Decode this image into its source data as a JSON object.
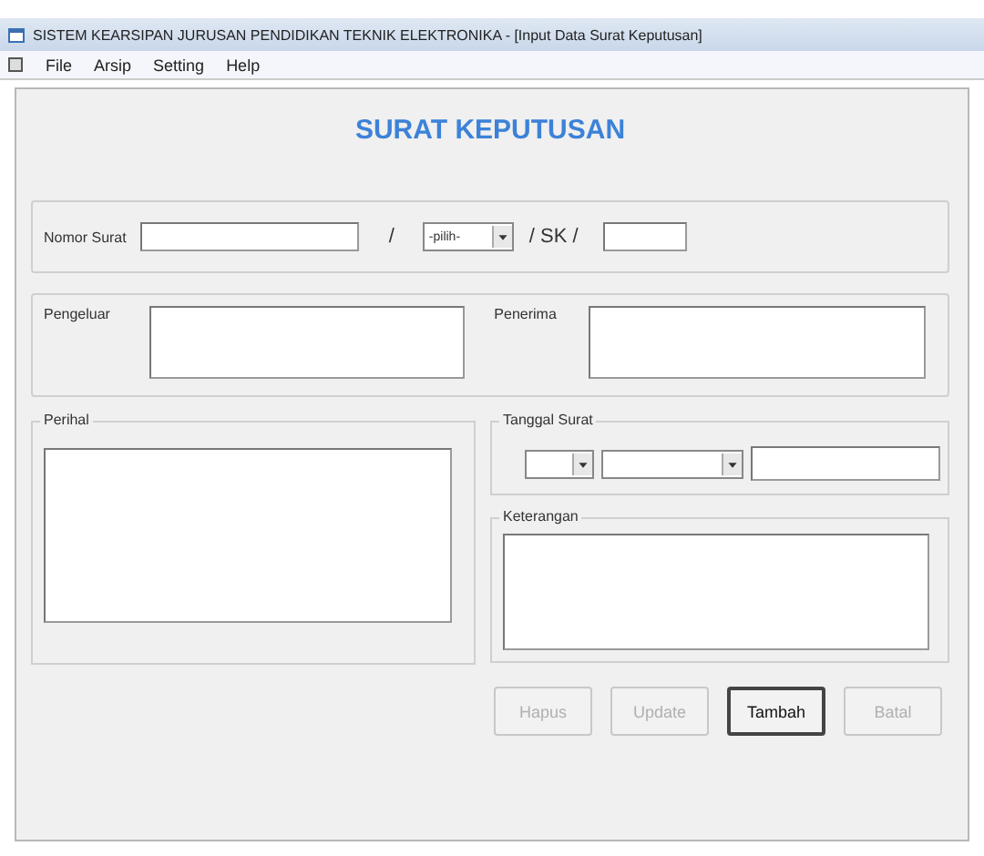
{
  "window": {
    "title": "SISTEM KEARSIPAN  JURUSAN PENDIDIKAN TEKNIK ELEKTRONIKA - [Input Data Surat Keputusan]"
  },
  "menu": [
    "File",
    "Arsip",
    "Setting",
    "Help"
  ],
  "form_title": "SURAT KEPUTUSAN",
  "nomor": {
    "label": "Nomor Surat",
    "sep1": "/",
    "select_value": "-pilih-",
    "sep2": "/ SK /"
  },
  "pengeluar": {
    "label": "Pengeluar"
  },
  "penerima": {
    "label": "Penerima"
  },
  "perihal": {
    "label": "Perihal"
  },
  "tanggal": {
    "label": "Tanggal Surat"
  },
  "keterangan": {
    "label": "Keterangan"
  },
  "buttons": [
    {
      "label": "Hapus",
      "disabled": true,
      "focused": false
    },
    {
      "label": "Update",
      "disabled": true,
      "focused": false
    },
    {
      "label": "Tambah",
      "disabled": false,
      "focused": true
    },
    {
      "label": "Batal",
      "disabled": true,
      "focused": false
    }
  ]
}
